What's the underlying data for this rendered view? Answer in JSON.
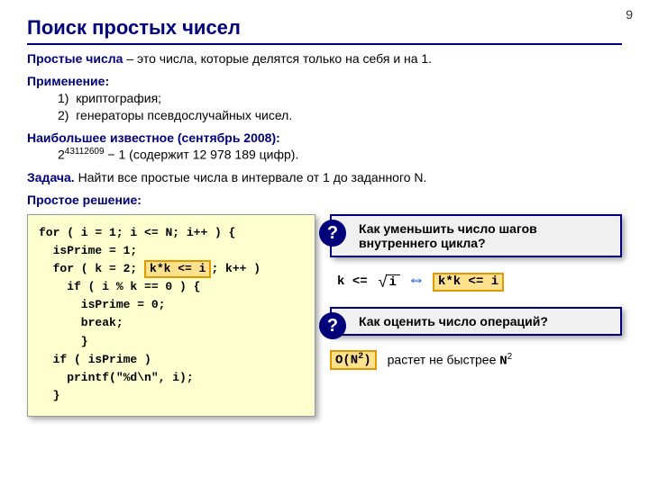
{
  "page_number": "9",
  "title": "Поиск простых чисел",
  "intro_label": "Простые числа",
  "intro_rest": " – это числа, которые делятся только на себя и на 1.",
  "applications_label": "Применение:",
  "applications": {
    "n1": "1)",
    "item1": "криптография;",
    "n2": "2)",
    "item2": "генераторы псевдослучайных чисел."
  },
  "largest_label": "Наибольшее известное (сентябрь 2008):",
  "largest_base": "2",
  "largest_exp": "43112609",
  "largest_rest": " − 1 (содержит 12 978 189 цифр).",
  "task_label": "Задача.",
  "task_text": " Найти все простые числа в интервале от 1 до заданного N.",
  "simple_label": "Простое решение:",
  "code": {
    "l1a": "for ( i = 1; i ",
    "l1b": "<=",
    "l1c": " N; i++ ) {",
    "l2": "  isPrime = 1;",
    "l3a": "  for ( k = 2; ",
    "l3_hl": "k*k <= i",
    "l3b": "; k++ )",
    "l4": "    if ( i % k == 0 ) {",
    "l5": "      isPrime = 0;",
    "l6": "      break;",
    "l7": "      }",
    "l8": "  if ( isPrime )",
    "l9": "    printf(\"%d\\n\", i);",
    "l10": "  }"
  },
  "q1": "Как уменьшить число шагов внутреннего цикла?",
  "q_mark": "?",
  "formula": {
    "k": "k",
    "le": "<=",
    "i": "i"
  },
  "kk_box": "k*k <= i",
  "q2": "Как оценить число операций?",
  "bigO_a": "O(N",
  "bigO_exp": "2",
  "bigO_b": ")",
  "growth_a": "растет не быстрее ",
  "growth_N": "N",
  "growth_exp": "2"
}
